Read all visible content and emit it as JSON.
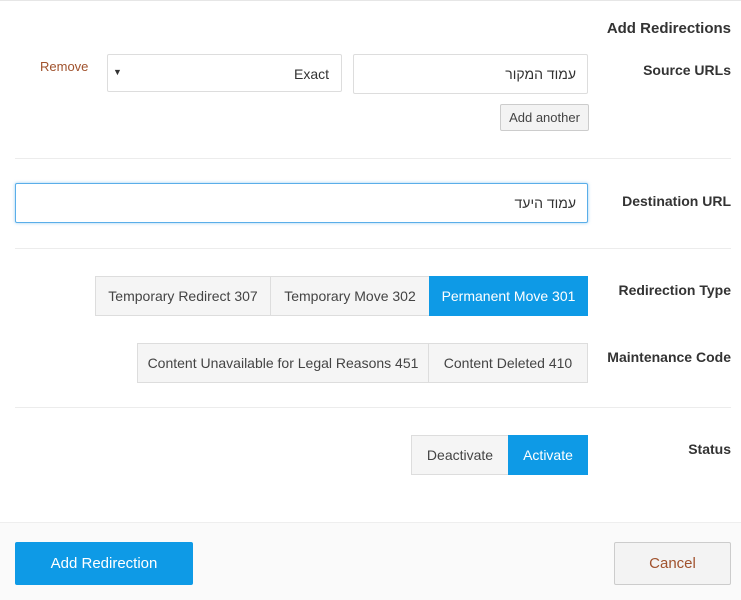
{
  "header": {
    "title": "Add Redirections"
  },
  "source": {
    "label": "Source URLs",
    "remove_label": "Remove",
    "match_type": "Exact",
    "url_value": "עמוד המקור",
    "add_another_label": "Add another"
  },
  "destination": {
    "label": "Destination URL",
    "value": "עמוד היעד"
  },
  "redirection_type": {
    "label": "Redirection Type",
    "options": [
      "Temporary Redirect 307",
      "Temporary Move 302",
      "Permanent Move 301"
    ],
    "selected": "Permanent Move 301"
  },
  "maintenance": {
    "label": "Maintenance Code",
    "options": [
      "Content Unavailable for Legal Reasons 451",
      "Content Deleted 410"
    ]
  },
  "status": {
    "label": "Status",
    "options": [
      "Deactivate",
      "Activate"
    ],
    "selected": "Activate"
  },
  "footer": {
    "submit_label": "Add Redirection",
    "cancel_label": "Cancel"
  },
  "colors": {
    "accent": "#0e9ae6",
    "link": "#a0522d"
  }
}
